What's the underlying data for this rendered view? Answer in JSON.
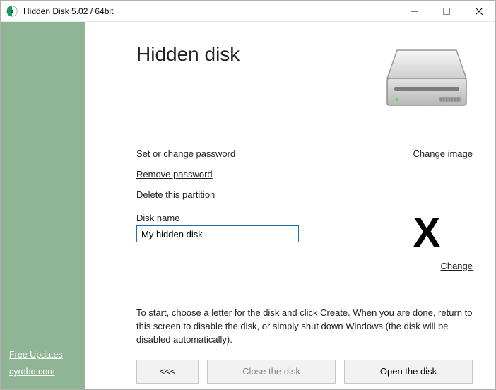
{
  "window": {
    "title": "Hidden Disk 5.02 / 64bit"
  },
  "sidebar": {
    "free_updates": "Free Updates",
    "site": "cyrobo.com"
  },
  "main": {
    "heading": "Hidden disk",
    "links": {
      "set_password": "Set or change password",
      "remove_password": "Remove password",
      "delete_partition": "Delete this partition",
      "change_image": "Change image",
      "change_letter": "Change"
    },
    "disk_name_label": "Disk name",
    "disk_name_value": "My hidden disk",
    "drive_letter": "X",
    "hint": "To start, choose a letter for the disk and click Create. When you are done, return to this screen to disable the disk, or simply shut down Windows (the disk will be disabled automatically).",
    "buttons": {
      "back": "<<<",
      "close_disk": "Close the disk",
      "open_disk": "Open the disk"
    }
  }
}
